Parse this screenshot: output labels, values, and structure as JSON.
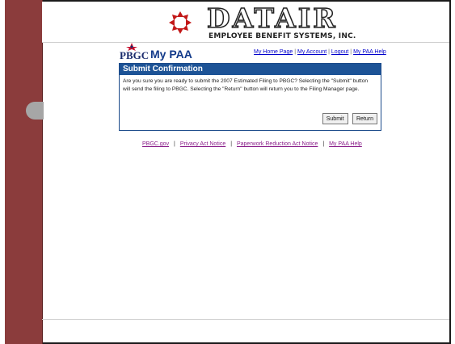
{
  "header": {
    "brand_name": "DATAIR",
    "brand_subtitle": "EMPLOYEE BENEFIT SYSTEMS, INC."
  },
  "app": {
    "pbgc_label": "PBGC",
    "product_label": "My PAA"
  },
  "top_links": {
    "home": "My Home Page",
    "account": "My Account",
    "logout": "Logout",
    "help": "My PAA Help",
    "separator": "|"
  },
  "dialog": {
    "title": "Submit Confirmation",
    "message": "Are you sure you are ready to submit the 2007 Estimated Filing to PBGC? Selecting the \"Submit\" button will send the filing to PBGC. Selecting the \"Return\" button will return you to the Filing Manager page.",
    "submit_label": "Submit",
    "return_label": "Return"
  },
  "footer_links": {
    "pbgc_gov": "PBGC.gov",
    "privacy": "Privacy Act Notice",
    "paperwork": "Paperwork Reduction Act Notice",
    "help": "My PAA Help",
    "separator": "|"
  },
  "colors": {
    "sidebar": "#8b3c3c",
    "title_bar": "#1d5396",
    "link_blue": "#0000cc",
    "link_visited": "#8a1f8a"
  },
  "icons": {
    "company_logo": "datair-logo-icon",
    "pbgc_logo": "pbgc-logo-icon"
  }
}
